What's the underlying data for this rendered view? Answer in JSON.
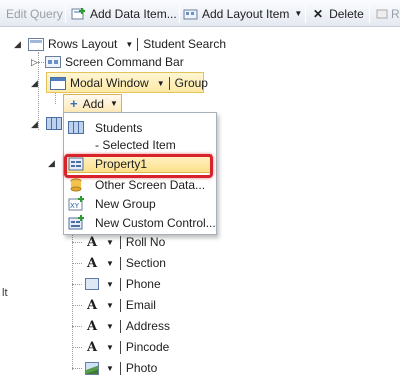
{
  "toolbar": {
    "edit_query": "Edit Query",
    "add_data_item": "Add Data Item...",
    "add_layout_item": "Add Layout Item",
    "delete": "Delete",
    "r_partial": "R"
  },
  "tree": {
    "root": {
      "label": "Rows Layout",
      "title": "Student Search"
    },
    "command_bar": {
      "label": "Screen Command Bar"
    },
    "modal": {
      "label": "Modal Window",
      "type": "Group"
    },
    "add_button": {
      "label": "Add"
    }
  },
  "menu": {
    "items": [
      {
        "label": "Students",
        "sublabel": "- Selected Item",
        "icon": "grid-icon"
      },
      {
        "label": "Property1",
        "icon": "property-icon",
        "highlighted": true
      },
      {
        "label": "Other Screen Data...",
        "icon": "data-icon"
      },
      {
        "label": "New Group",
        "icon": "new-group-icon"
      },
      {
        "label": "New Custom Control...",
        "icon": "custom-control-icon"
      }
    ]
  },
  "fields": [
    {
      "label": "Roll No",
      "icon": "text-icon"
    },
    {
      "label": "Section",
      "icon": "text-icon"
    },
    {
      "label": "Phone",
      "icon": "phone-icon"
    },
    {
      "label": "Email",
      "icon": "text-icon"
    },
    {
      "label": "Address",
      "icon": "text-icon"
    },
    {
      "label": "Pincode",
      "icon": "text-icon"
    },
    {
      "label": "Photo",
      "icon": "image-icon"
    }
  ],
  "edge_text": "lt",
  "colors": {
    "highlight_border": "#d8232a",
    "selection_fill": "#fde9a4",
    "accent": "#4f7fc0"
  }
}
